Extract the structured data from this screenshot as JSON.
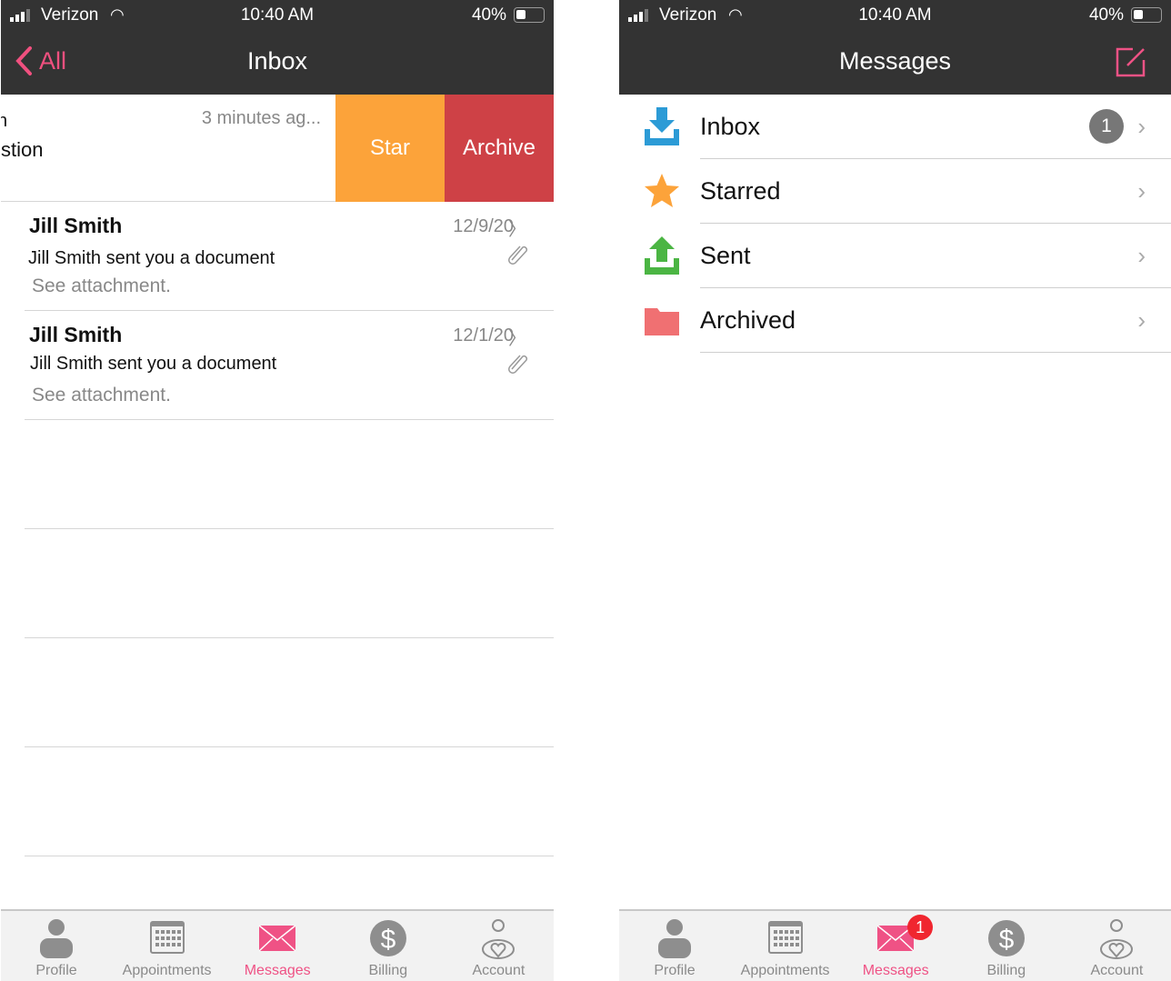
{
  "status": {
    "carrier": "Verizon",
    "time": "10:40 AM",
    "battery": "40%"
  },
  "left": {
    "nav": {
      "back": "All",
      "title": "Inbox"
    },
    "swiped": {
      "line1": "n",
      "time": "3 minutes ag...",
      "line2": "stion",
      "star": "Star",
      "archive": "Archive"
    },
    "messages": [
      {
        "sender": "Jill Smith",
        "date": "12/9/20",
        "subject": "Jill Smith sent you a document",
        "preview": "See attachment."
      },
      {
        "sender": "Jill Smith",
        "date": "12/1/20",
        "subject": "Jill Smith sent you a document",
        "preview": "See attachment."
      }
    ]
  },
  "right": {
    "nav": {
      "title": "Messages"
    },
    "folders": [
      {
        "label": "Inbox",
        "count": "1",
        "icon": "inbox-download-icon"
      },
      {
        "label": "Starred",
        "icon": "star-icon"
      },
      {
        "label": "Sent",
        "icon": "sent-upload-icon"
      },
      {
        "label": "Archived",
        "icon": "folder-icon"
      }
    ]
  },
  "tabs": [
    {
      "label": "Profile"
    },
    {
      "label": "Appointments"
    },
    {
      "label": "Messages"
    },
    {
      "label": "Billing"
    },
    {
      "label": "Account"
    }
  ],
  "tab_badge": "1",
  "colors": {
    "accent": "#ef5285",
    "star": "#fca33a",
    "archive": "#ce4146",
    "bar": "#333333"
  }
}
